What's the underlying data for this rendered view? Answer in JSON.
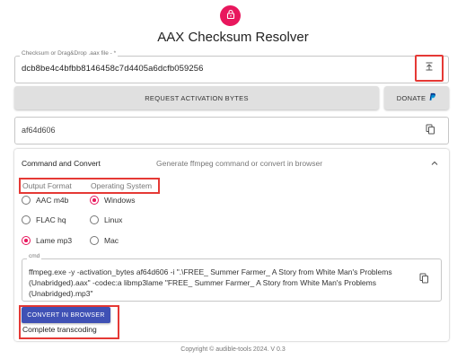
{
  "header": {
    "title": "AAX Checksum Resolver",
    "logo_icon": "lock-icon",
    "brand_color": "#e8175d"
  },
  "checksum": {
    "label": "Checksum or Drag&Drop .aax file - *",
    "value": "dcb8be4c4bfbb8146458c7d4405a6dcfb059256",
    "upload_icon": "upload-icon"
  },
  "actions": {
    "request_label": "REQUEST ACTIVATION BYTES",
    "donate_label": "DONATE",
    "donate_icon": "paypal-icon"
  },
  "activation": {
    "value": "af64d606",
    "copy_icon": "copy-icon"
  },
  "panel": {
    "title": "Command and Convert",
    "subtitle": "Generate ffmpeg command or convert in browser",
    "output_format_label": "Output Format",
    "os_label": "Operating System",
    "output_formats": [
      {
        "label": "AAC m4b",
        "selected": false
      },
      {
        "label": "FLAC hq",
        "selected": false
      },
      {
        "label": "Lame mp3",
        "selected": true
      }
    ],
    "operating_systems": [
      {
        "label": "Windows",
        "selected": true
      },
      {
        "label": "Linux",
        "selected": false
      },
      {
        "label": "Mac",
        "selected": false
      }
    ],
    "cmd_label": "cmd",
    "cmd_text": "ffmpeg.exe -y -activation_bytes af64d606 -i  \".\\FREE_ Summer Farmer_ A Story from White Man's Problems (Unabridged).aax\" -codec:a libmp3lame \"FREE_ Summer Farmer_ A Story from White Man's Problems (Unabridged).mp3\"",
    "convert_label": "CONVERT IN BROWSER",
    "status": "Complete transcoding"
  },
  "footer": {
    "copyright": "Copyright © audible-tools 2024. V 0.3"
  },
  "colors": {
    "accent": "#e8175d",
    "primary": "#3f51b5",
    "highlight": "#e53935"
  }
}
